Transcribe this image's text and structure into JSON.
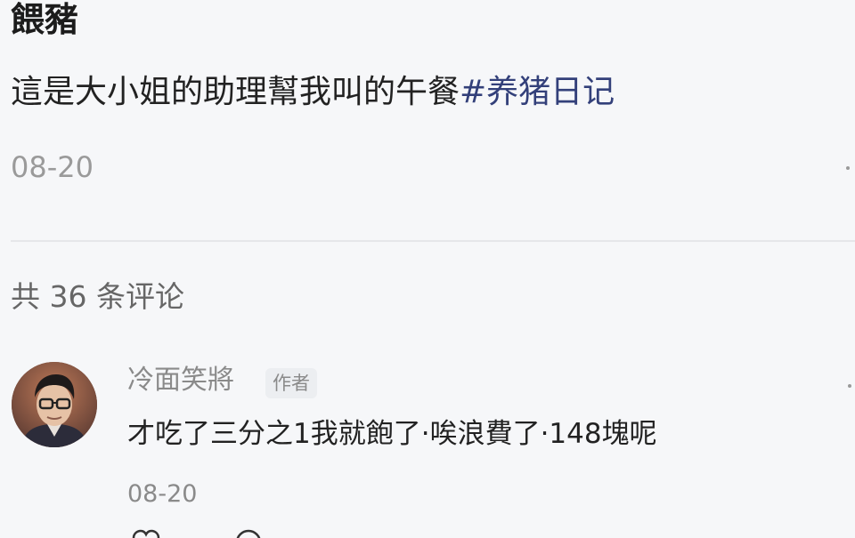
{
  "post": {
    "title": "餵豬",
    "body_text": "這是大小姐的助理幫我叫的午餐",
    "hashtag": "#养猪日记",
    "date": "08-20"
  },
  "comments": {
    "count_label": "共 36 条评论",
    "items": [
      {
        "author": "冷面笑將",
        "badge": "作者",
        "text": "才吃了三分之1我就飽了·唉浪費了·148塊呢",
        "date": "08-20"
      }
    ]
  },
  "icons": {
    "more": "more-icon",
    "like": "heart-icon",
    "reply": "comment-icon"
  },
  "colors": {
    "background": "#f6f7f9",
    "hashtag": "#33407a",
    "secondary_text": "#9a9a9a"
  }
}
